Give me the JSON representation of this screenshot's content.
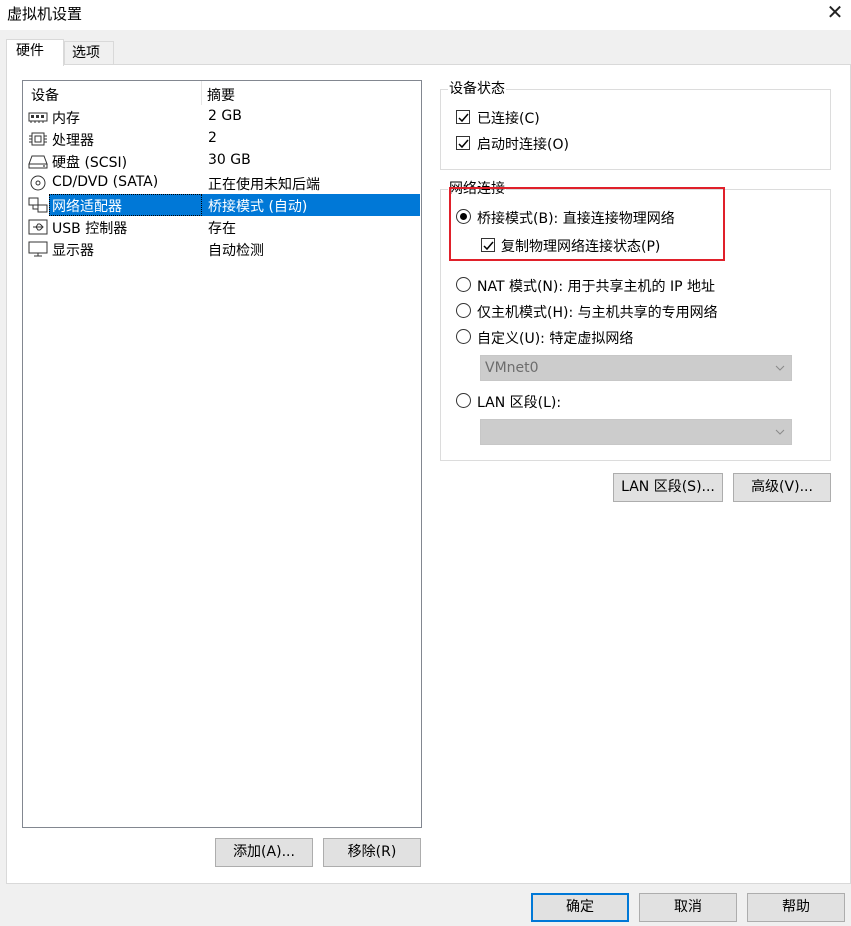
{
  "window": {
    "title": "虚拟机设置",
    "close_glyph": "✕"
  },
  "tabs": [
    {
      "label": "硬件"
    },
    {
      "label": "选项"
    }
  ],
  "device_list": {
    "columns": [
      "设备",
      "摘要"
    ],
    "rows": [
      {
        "icon": "memory-icon",
        "name": "内存",
        "summary": "2 GB"
      },
      {
        "icon": "processor-icon",
        "name": "处理器",
        "summary": "2"
      },
      {
        "icon": "hard-disk-icon",
        "name": "硬盘 (SCSI)",
        "summary": "30 GB"
      },
      {
        "icon": "cd-dvd-icon",
        "name": "CD/DVD (SATA)",
        "summary": "正在使用未知后端"
      },
      {
        "icon": "network-adapter-icon",
        "name": "网络适配器",
        "summary": "桥接模式 (自动)",
        "selected": true
      },
      {
        "icon": "usb-icon",
        "name": "USB 控制器",
        "summary": "存在"
      },
      {
        "icon": "display-icon",
        "name": "显示器",
        "summary": "自动检测"
      }
    ]
  },
  "list_buttons": {
    "add": "添加(A)...",
    "remove": "移除(R)"
  },
  "device_status": {
    "title": "设备状态",
    "connected": {
      "label": "已连接(C)",
      "checked": true
    },
    "connect_at_power_on": {
      "label": "启动时连接(O)",
      "checked": true
    }
  },
  "network_connection": {
    "title": "网络连接",
    "bridged": {
      "label": "桥接模式(B): 直接连接物理网络",
      "selected": true
    },
    "replicate": {
      "label": "复制物理网络连接状态(P)",
      "checked": true
    },
    "nat": {
      "label": "NAT 模式(N): 用于共享主机的 IP 地址",
      "selected": false
    },
    "host_only": {
      "label": "仅主机模式(H): 与主机共享的专用网络",
      "selected": false
    },
    "custom": {
      "label": "自定义(U): 特定虚拟网络",
      "selected": false
    },
    "custom_select_value": "VMnet0",
    "lan_segment": {
      "label": "LAN 区段(L):",
      "selected": false
    },
    "lan_segment_value": ""
  },
  "side_buttons": {
    "lan_segments": "LAN 区段(S)...",
    "advanced": "高级(V)..."
  },
  "dialog_buttons": {
    "ok": "确定",
    "cancel": "取消",
    "help": "帮助"
  },
  "colors": {
    "selection": "#0078d7",
    "highlight_box": "#e0202a",
    "dialog_bg": "#f0f0f0"
  }
}
